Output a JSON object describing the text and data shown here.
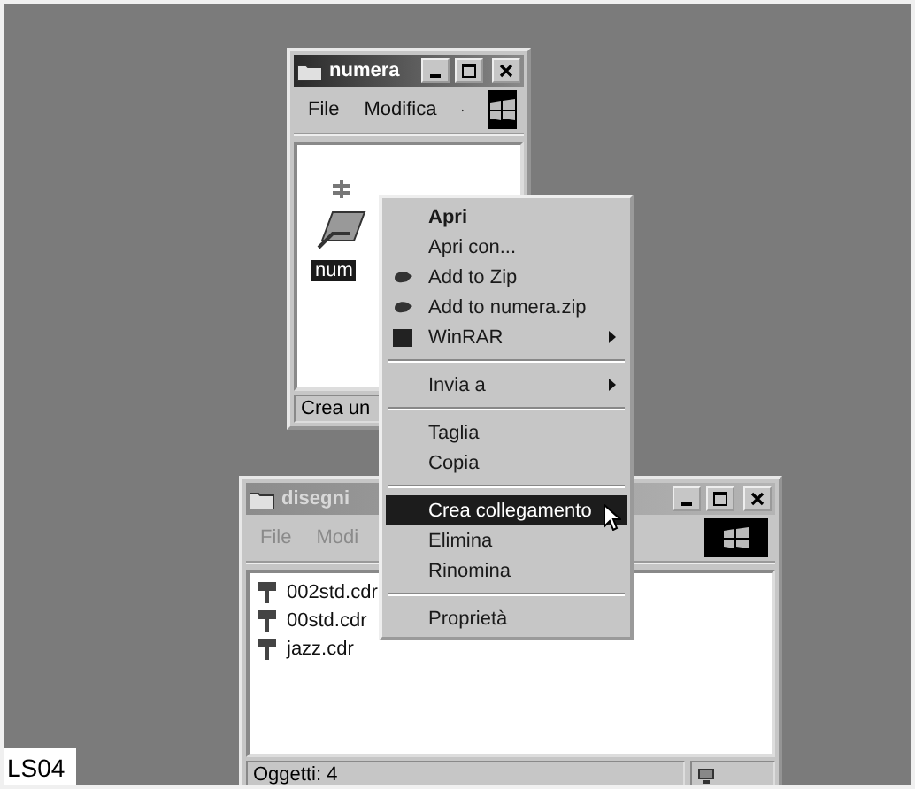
{
  "label": "LS04",
  "windows": [
    {
      "title": "numera",
      "active": true,
      "menu": [
        {
          "label": "File",
          "disabled": false
        },
        {
          "label": "Modifica",
          "disabled": false
        }
      ],
      "items": [
        {
          "name": "num",
          "selected": true,
          "kind": "zip"
        }
      ],
      "status": [
        "Crea un"
      ]
    },
    {
      "title": "disegni",
      "active": false,
      "menu": [
        {
          "label": "File",
          "disabled": true
        },
        {
          "label": "Modi",
          "disabled": true
        }
      ],
      "items": [
        {
          "name": "002std.cdr",
          "selected": false,
          "kind": "cdr"
        },
        {
          "name": "00std.cdr",
          "selected": false,
          "kind": "cdr"
        },
        {
          "name": "jazz.cdr",
          "selected": false,
          "kind": "cdr"
        }
      ],
      "status": [
        "Oggetti: 4"
      ]
    }
  ],
  "context_menu": [
    {
      "kind": "item",
      "label": "Apri",
      "default": true,
      "submenu": false,
      "selected": false
    },
    {
      "kind": "item",
      "label": "Apri con...",
      "default": false,
      "submenu": false,
      "selected": false
    },
    {
      "kind": "zip",
      "label": "Add to Zip",
      "default": false,
      "submenu": false,
      "selected": false
    },
    {
      "kind": "zip",
      "label": "Add to numera.zip",
      "default": false,
      "submenu": false,
      "selected": false
    },
    {
      "kind": "rar",
      "label": "WinRAR",
      "default": false,
      "submenu": true,
      "selected": false
    },
    {
      "kind": "separator"
    },
    {
      "kind": "item",
      "label": "Invia a",
      "default": false,
      "submenu": true,
      "selected": false
    },
    {
      "kind": "separator"
    },
    {
      "kind": "item",
      "label": "Taglia",
      "default": false,
      "submenu": false,
      "selected": false
    },
    {
      "kind": "item",
      "label": "Copia",
      "default": false,
      "submenu": false,
      "selected": false
    },
    {
      "kind": "separator"
    },
    {
      "kind": "item",
      "label": "Crea collegamento",
      "default": false,
      "submenu": false,
      "selected": true
    },
    {
      "kind": "item",
      "label": "Elimina",
      "default": false,
      "submenu": false,
      "selected": false
    },
    {
      "kind": "item",
      "label": "Rinomina",
      "default": false,
      "submenu": false,
      "selected": false
    },
    {
      "kind": "separator"
    },
    {
      "kind": "item",
      "label": "Proprietà",
      "default": false,
      "submenu": false,
      "selected": false
    }
  ]
}
